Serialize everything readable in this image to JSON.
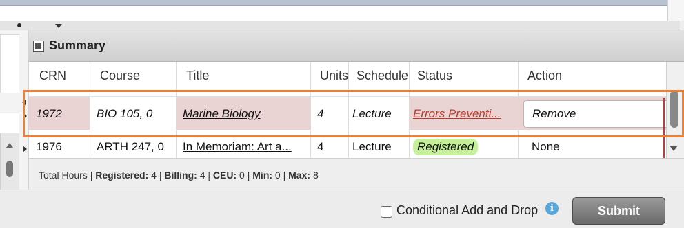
{
  "panel": {
    "title": "Summary"
  },
  "columns": [
    "CRN",
    "Course",
    "Title",
    "Units",
    "Schedule",
    "Status",
    "Action"
  ],
  "rows": [
    {
      "crn": "1972",
      "course": "BIO 105, 0",
      "title": "Marine Biology",
      "units": "4",
      "schedule": "Lecture",
      "status": "Errors Preventi...",
      "action": "Remove"
    },
    {
      "crn": "1976",
      "course": "ARTH 247, 0",
      "title": "In Memoriam: Art a...",
      "units": "4",
      "schedule": "Lecture",
      "status": "Registered",
      "action": "None"
    }
  ],
  "footer": {
    "prefix": "Total Hours |",
    "registered_label": "Registered:",
    "registered_value": "4",
    "billing_label": "Billing:",
    "billing_value": "4",
    "ceu_label": "CEU:",
    "ceu_value": "0",
    "min_label": "Min:",
    "min_value": "0",
    "max_label": "Max:",
    "max_value": "8"
  },
  "bottom": {
    "conditional_label": "Conditional Add and Drop",
    "submit_label": "Submit"
  },
  "colors": {
    "error": "#c0392b",
    "registered_badge": "#c6f09a",
    "highlight": "#f08030",
    "row_error_bg": "#ead3d3"
  }
}
